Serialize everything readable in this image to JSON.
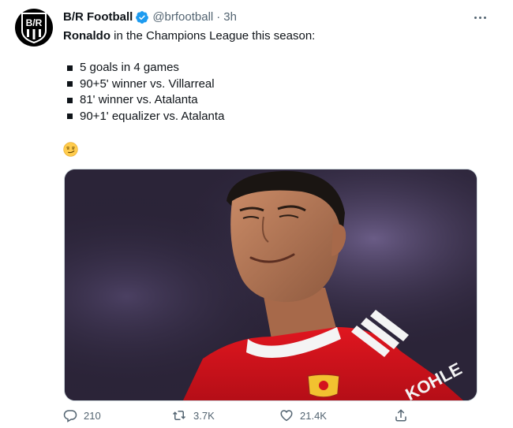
{
  "author": {
    "name": "B/R Football",
    "handle": "@brfootball",
    "separator": "·",
    "time": "3h",
    "avatar_text": "B/R"
  },
  "tweet": {
    "lead_bold": "Ronaldo",
    "lead_rest": " in the Champions League this season:",
    "bullets": [
      "5 goals in 4 games",
      "90+5' winner vs. Villarreal",
      "81' winner vs. Atalanta",
      "90+1' equalizer vs. Atalanta"
    ],
    "emoji": "smirking-face"
  },
  "media": {
    "description_icon": "photo",
    "jersey_text": "KOHLE",
    "crest_text": "MANCHESTER UNITED"
  },
  "actions": {
    "replies": "210",
    "retweets": "3.7K",
    "likes": "21.4K"
  },
  "colors": {
    "text": "#0f1419",
    "secondary": "#536471",
    "verified": "#1d9bf0",
    "jersey": "#d4131d"
  }
}
